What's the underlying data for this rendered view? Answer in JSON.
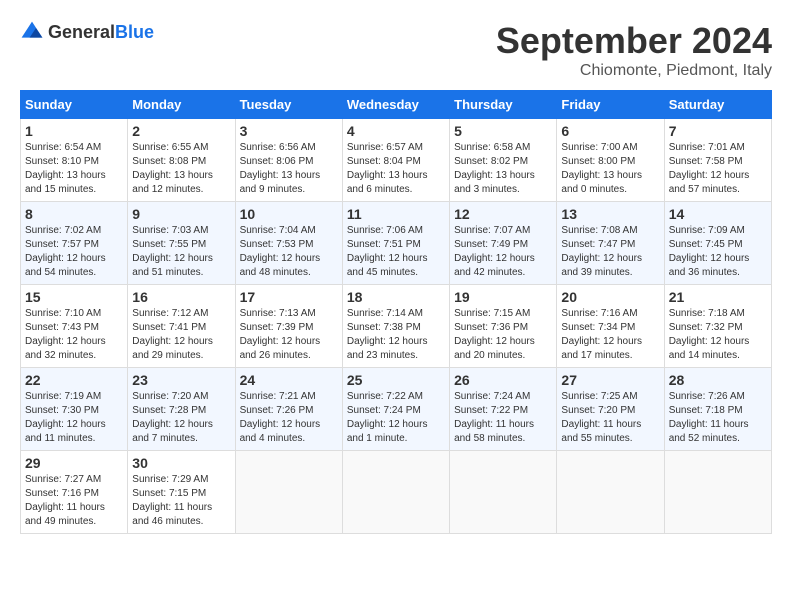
{
  "header": {
    "logo_general": "General",
    "logo_blue": "Blue",
    "month_title": "September 2024",
    "location": "Chiomonte, Piedmont, Italy"
  },
  "columns": [
    "Sunday",
    "Monday",
    "Tuesday",
    "Wednesday",
    "Thursday",
    "Friday",
    "Saturday"
  ],
  "weeks": [
    {
      "days": [
        {
          "num": "1",
          "info": "Sunrise: 6:54 AM\nSunset: 8:10 PM\nDaylight: 13 hours\nand 15 minutes."
        },
        {
          "num": "2",
          "info": "Sunrise: 6:55 AM\nSunset: 8:08 PM\nDaylight: 13 hours\nand 12 minutes."
        },
        {
          "num": "3",
          "info": "Sunrise: 6:56 AM\nSunset: 8:06 PM\nDaylight: 13 hours\nand 9 minutes."
        },
        {
          "num": "4",
          "info": "Sunrise: 6:57 AM\nSunset: 8:04 PM\nDaylight: 13 hours\nand 6 minutes."
        },
        {
          "num": "5",
          "info": "Sunrise: 6:58 AM\nSunset: 8:02 PM\nDaylight: 13 hours\nand 3 minutes."
        },
        {
          "num": "6",
          "info": "Sunrise: 7:00 AM\nSunset: 8:00 PM\nDaylight: 13 hours\nand 0 minutes."
        },
        {
          "num": "7",
          "info": "Sunrise: 7:01 AM\nSunset: 7:58 PM\nDaylight: 12 hours\nand 57 minutes."
        }
      ]
    },
    {
      "days": [
        {
          "num": "8",
          "info": "Sunrise: 7:02 AM\nSunset: 7:57 PM\nDaylight: 12 hours\nand 54 minutes."
        },
        {
          "num": "9",
          "info": "Sunrise: 7:03 AM\nSunset: 7:55 PM\nDaylight: 12 hours\nand 51 minutes."
        },
        {
          "num": "10",
          "info": "Sunrise: 7:04 AM\nSunset: 7:53 PM\nDaylight: 12 hours\nand 48 minutes."
        },
        {
          "num": "11",
          "info": "Sunrise: 7:06 AM\nSunset: 7:51 PM\nDaylight: 12 hours\nand 45 minutes."
        },
        {
          "num": "12",
          "info": "Sunrise: 7:07 AM\nSunset: 7:49 PM\nDaylight: 12 hours\nand 42 minutes."
        },
        {
          "num": "13",
          "info": "Sunrise: 7:08 AM\nSunset: 7:47 PM\nDaylight: 12 hours\nand 39 minutes."
        },
        {
          "num": "14",
          "info": "Sunrise: 7:09 AM\nSunset: 7:45 PM\nDaylight: 12 hours\nand 36 minutes."
        }
      ]
    },
    {
      "days": [
        {
          "num": "15",
          "info": "Sunrise: 7:10 AM\nSunset: 7:43 PM\nDaylight: 12 hours\nand 32 minutes."
        },
        {
          "num": "16",
          "info": "Sunrise: 7:12 AM\nSunset: 7:41 PM\nDaylight: 12 hours\nand 29 minutes."
        },
        {
          "num": "17",
          "info": "Sunrise: 7:13 AM\nSunset: 7:39 PM\nDaylight: 12 hours\nand 26 minutes."
        },
        {
          "num": "18",
          "info": "Sunrise: 7:14 AM\nSunset: 7:38 PM\nDaylight: 12 hours\nand 23 minutes."
        },
        {
          "num": "19",
          "info": "Sunrise: 7:15 AM\nSunset: 7:36 PM\nDaylight: 12 hours\nand 20 minutes."
        },
        {
          "num": "20",
          "info": "Sunrise: 7:16 AM\nSunset: 7:34 PM\nDaylight: 12 hours\nand 17 minutes."
        },
        {
          "num": "21",
          "info": "Sunrise: 7:18 AM\nSunset: 7:32 PM\nDaylight: 12 hours\nand 14 minutes."
        }
      ]
    },
    {
      "days": [
        {
          "num": "22",
          "info": "Sunrise: 7:19 AM\nSunset: 7:30 PM\nDaylight: 12 hours\nand 11 minutes."
        },
        {
          "num": "23",
          "info": "Sunrise: 7:20 AM\nSunset: 7:28 PM\nDaylight: 12 hours\nand 7 minutes."
        },
        {
          "num": "24",
          "info": "Sunrise: 7:21 AM\nSunset: 7:26 PM\nDaylight: 12 hours\nand 4 minutes."
        },
        {
          "num": "25",
          "info": "Sunrise: 7:22 AM\nSunset: 7:24 PM\nDaylight: 12 hours\nand 1 minute."
        },
        {
          "num": "26",
          "info": "Sunrise: 7:24 AM\nSunset: 7:22 PM\nDaylight: 11 hours\nand 58 minutes."
        },
        {
          "num": "27",
          "info": "Sunrise: 7:25 AM\nSunset: 7:20 PM\nDaylight: 11 hours\nand 55 minutes."
        },
        {
          "num": "28",
          "info": "Sunrise: 7:26 AM\nSunset: 7:18 PM\nDaylight: 11 hours\nand 52 minutes."
        }
      ]
    },
    {
      "days": [
        {
          "num": "29",
          "info": "Sunrise: 7:27 AM\nSunset: 7:16 PM\nDaylight: 11 hours\nand 49 minutes."
        },
        {
          "num": "30",
          "info": "Sunrise: 7:29 AM\nSunset: 7:15 PM\nDaylight: 11 hours\nand 46 minutes."
        },
        {
          "num": "",
          "info": ""
        },
        {
          "num": "",
          "info": ""
        },
        {
          "num": "",
          "info": ""
        },
        {
          "num": "",
          "info": ""
        },
        {
          "num": "",
          "info": ""
        }
      ]
    }
  ]
}
